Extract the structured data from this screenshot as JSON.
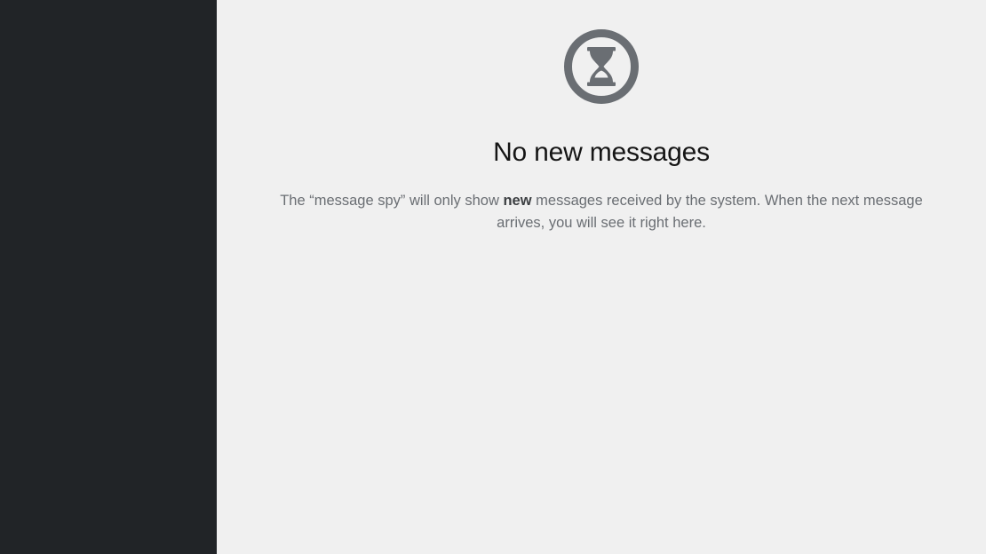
{
  "sidebar": {},
  "empty_state": {
    "icon": "hourglass-icon",
    "icon_color": "#6a6e73",
    "title": "No new messages",
    "body_before": "The “message spy” will only show ",
    "body_emphasis": "new",
    "body_after": " messages received by the system. When the next message arrives, you will see it right here."
  }
}
